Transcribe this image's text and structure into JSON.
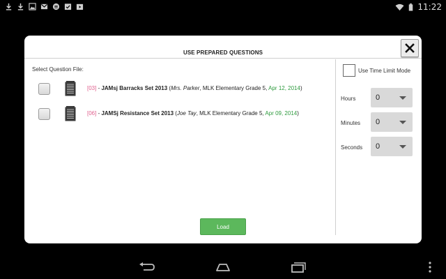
{
  "status_bar": {
    "left_icons": [
      "download-icon",
      "download-icon",
      "image-icon",
      "gmail-icon",
      "music-icon",
      "calendar-check-icon",
      "play-store-icon"
    ],
    "right_icons": [
      "wifi-icon",
      "battery-icon"
    ],
    "clock": "11:22"
  },
  "dialog": {
    "title": "USE PREPARED QUESTIONS",
    "select_label": "Select Question File:",
    "files": [
      {
        "id": "[03]",
        "separator": " - ",
        "name": "JAMsj Barracks Set 2013",
        "open": " (",
        "author": "Mrs. Parker",
        "school": ", MLK Elementary Grade 5, ",
        "date": "Apr 12, 2014",
        "close": ")",
        "checked": false
      },
      {
        "id": "[06]",
        "separator": " - ",
        "name": "JAMSj Resistance Set 2013",
        "open": " (",
        "author": "Joe Tay",
        "school": ", MLK Elementary Grade 5, ",
        "date": "Apr 09, 2014",
        "close": ")",
        "checked": false
      }
    ],
    "load_label": "Load",
    "time_limit_label": "Use Time Limit Mode",
    "time_limit_checked": false,
    "hours_label": "Hours",
    "hours_value": "0",
    "minutes_label": "Minutes",
    "minutes_value": "0",
    "seconds_label": "Seconds",
    "seconds_value": "0"
  },
  "colors": {
    "file_id": "#e0608e",
    "file_date": "#2e9a3e",
    "load_button": "#5cb85c"
  },
  "nav_bar": {
    "icons": [
      "back-icon",
      "home-icon",
      "recents-icon",
      "overflow-menu-icon"
    ]
  }
}
